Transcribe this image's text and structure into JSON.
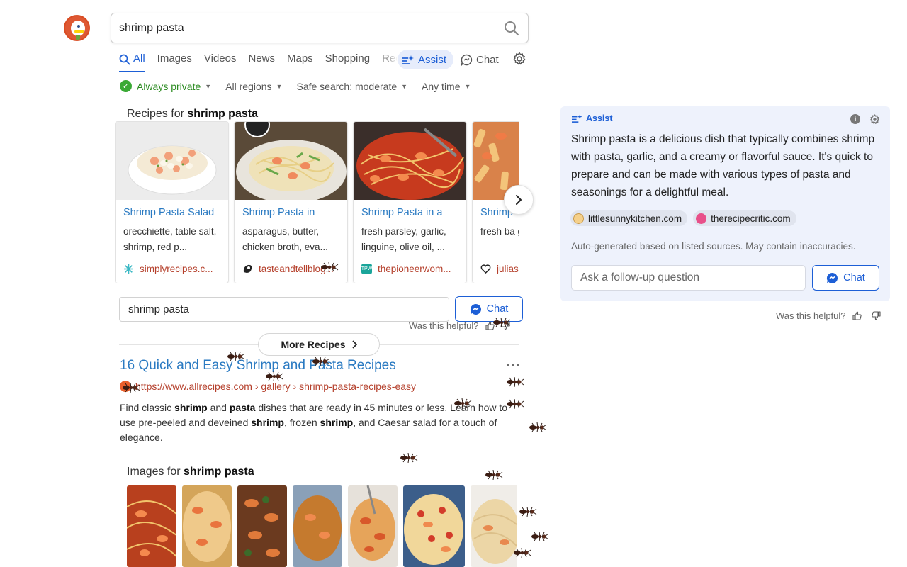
{
  "search": {
    "query": "shrimp pasta"
  },
  "tabs": [
    {
      "label": "All",
      "active": true
    },
    {
      "label": "Images"
    },
    {
      "label": "Videos"
    },
    {
      "label": "News"
    },
    {
      "label": "Maps"
    },
    {
      "label": "Shopping"
    },
    {
      "label": "Rec"
    }
  ],
  "assist_tab": "Assist",
  "chat_tab": "Chat",
  "filters": {
    "privacy": "Always private",
    "region": "All regions",
    "safe_search": "Safe search: moderate",
    "time": "Any time"
  },
  "recipes": {
    "title_prefix": "Recipes for ",
    "title_query": "shrimp pasta",
    "cards": [
      {
        "title": "Shrimp Pasta Salad",
        "desc": "orecchiette, table salt, shrimp, red p...",
        "source": "simplyrecipes.c...",
        "source_color": "#3ab8c4",
        "image_theme": "salad"
      },
      {
        "title": "Shrimp Pasta in",
        "desc": "asparagus, butter, chicken broth, eva...",
        "source": "tasteandtellblog...",
        "source_color": "#222222",
        "image_theme": "linguine"
      },
      {
        "title": "Shrimp Pasta in a",
        "desc": "fresh parsley, garlic, linguine, olive oil, ...",
        "source": "thepioneerwom...",
        "source_color": "#1aa59a",
        "image_theme": "spaghetti"
      },
      {
        "title": "Shrimp",
        "desc": "fresh ba garlic, ha",
        "source": "julias",
        "source_color": "#222222",
        "image_theme": "penne"
      }
    ],
    "followup_value": "shrimp pasta",
    "chat_label": "Chat",
    "helpful_label": "Was this helpful?",
    "more_label": "More Recipes"
  },
  "result": {
    "title": "16 Quick and Easy Shrimp and Pasta Recipes",
    "url": "https://www.allrecipes.com › gallery › shrimp-pasta-recipes-easy",
    "more_icon": "ellipsis-icon"
  },
  "images": {
    "title_prefix": "Images for ",
    "title_query": "shrimp pasta"
  },
  "assist": {
    "label": "Assist",
    "text": "Shrimp pasta is a delicious dish that typically combines shrimp with pasta, garlic, and a creamy or flavorful sauce. It's quick to prepare and can be made with various types of pasta and seasonings for a delightful meal.",
    "sources": [
      "littlesunnykitchen.com",
      "therecipecritic.com"
    ],
    "note": "Auto-generated based on listed sources. May contain inaccuracies.",
    "placeholder": "Ask a follow-up question",
    "chat_label": "Chat",
    "helpful_label": "Was this helpful?"
  },
  "colors": {
    "accent_blue": "#1d5fd6",
    "link_blue": "#2a7ac2",
    "url_red": "#b5402c",
    "private_green": "#2a8a1f",
    "assist_bg": "#eef2fc"
  }
}
